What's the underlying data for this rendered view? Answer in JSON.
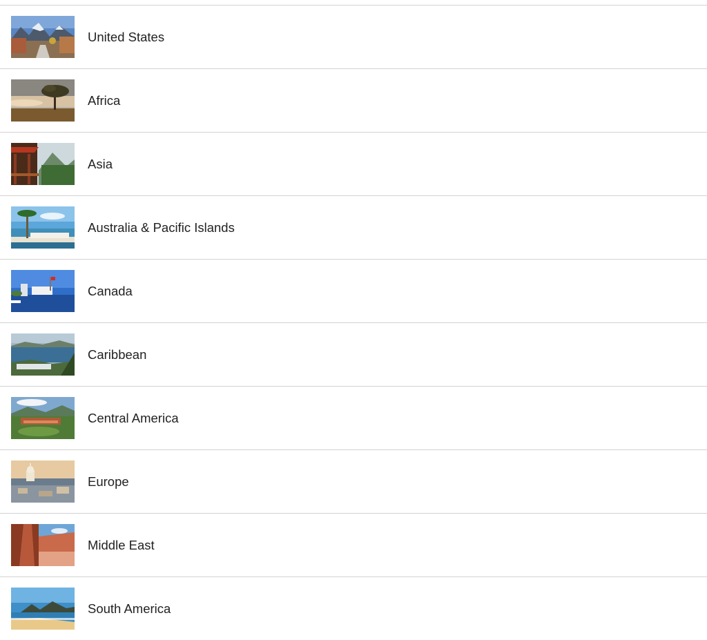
{
  "regions": [
    {
      "label": "United States",
      "image": "mountain-town-street-photo"
    },
    {
      "label": "Africa",
      "image": "savanna-acacia-tree-photo"
    },
    {
      "label": "Asia",
      "image": "pagoda-mountain-forest-photo"
    },
    {
      "label": "Australia & Pacific Islands",
      "image": "palm-tree-ocean-resort-photo"
    },
    {
      "label": "Canada",
      "image": "harbor-city-flag-photo"
    },
    {
      "label": "Caribbean",
      "image": "tropical-bay-coastline-photo"
    },
    {
      "label": "Central America",
      "image": "jungle-resort-mountains-photo"
    },
    {
      "label": "Europe",
      "image": "old-city-basilica-skyline-photo"
    },
    {
      "label": "Middle East",
      "image": "red-rock-canyon-photo"
    },
    {
      "label": "South America",
      "image": "beach-mountain-bay-photo"
    }
  ]
}
